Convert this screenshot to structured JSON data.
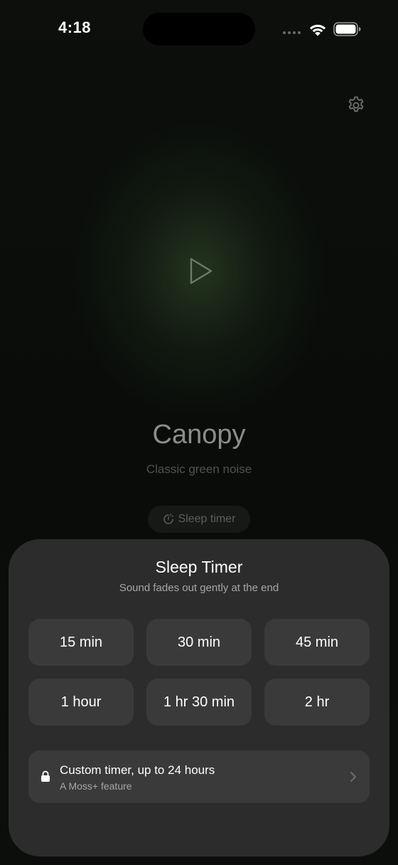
{
  "status_bar": {
    "time": "4:18"
  },
  "player": {
    "title": "Canopy",
    "subtitle": "Classic green noise",
    "sleep_timer_label": "Sleep timer"
  },
  "sleep_sheet": {
    "title": "Sleep Timer",
    "subtitle": "Sound fades out gently at the end",
    "options": [
      {
        "label": "15 min"
      },
      {
        "label": "30 min"
      },
      {
        "label": "45 min"
      },
      {
        "label": "1 hour"
      },
      {
        "label": "1 hr 30 min"
      },
      {
        "label": "2 hr"
      }
    ],
    "custom": {
      "title": "Custom timer, up to 24 hours",
      "subtitle": "A Moss+ feature"
    }
  },
  "colors": {
    "sheet_bg": "#2c2c2c",
    "button_bg": "#3a3a3a",
    "glow_green": "#375530"
  },
  "icons": [
    "wifi-icon",
    "battery-icon",
    "gear-icon",
    "play-icon",
    "moon-timer-icon",
    "lock-icon",
    "chevron-right-icon"
  ]
}
